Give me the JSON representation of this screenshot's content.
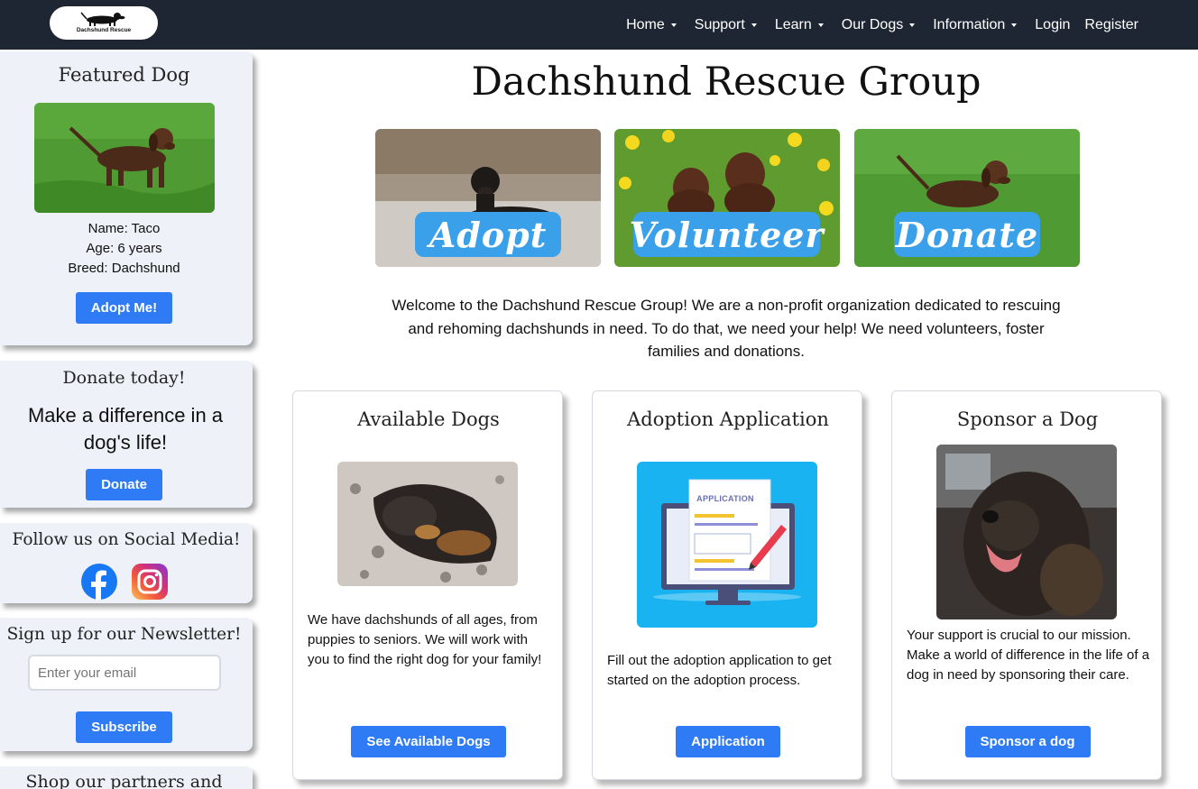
{
  "header": {
    "logo_text": "Dachshund Rescue",
    "nav": [
      {
        "label": "Home",
        "dropdown": true
      },
      {
        "label": "Support",
        "dropdown": true
      },
      {
        "label": "Learn",
        "dropdown": true
      },
      {
        "label": "Our Dogs",
        "dropdown": true
      },
      {
        "label": "Information",
        "dropdown": true
      },
      {
        "label": "Login",
        "dropdown": false
      },
      {
        "label": "Register",
        "dropdown": false
      }
    ]
  },
  "sidebar": {
    "featured": {
      "title": "Featured Dog",
      "name": "Name: Taco",
      "age": "Age: 6 years",
      "breed": "Breed: Dachshund",
      "button": "Adopt Me!"
    },
    "donate": {
      "title": "Donate today!",
      "text": "Make a difference in a dog's life!",
      "button": "Donate"
    },
    "social": {
      "title": "Follow us on Social Media!",
      "icons": [
        "facebook-icon",
        "instagram-icon"
      ]
    },
    "newsletter": {
      "title": "Sign up for our Newsletter!",
      "placeholder": "Enter your email",
      "button": "Subscribe"
    },
    "shop": {
      "title": "Shop our partners and"
    }
  },
  "main": {
    "title": "Dachshund Rescue Group",
    "heroes": [
      {
        "label": "Adopt"
      },
      {
        "label": "Volunteer"
      },
      {
        "label": "Donate"
      }
    ],
    "welcome": "Welcome to the Dachshund Rescue Group! We are a non-profit organization dedicated to rescuing and rehoming dachshunds in need. To do that, we need your help! We need volunteers, foster families and donations.",
    "cards": [
      {
        "title": "Available Dogs",
        "text": "We have dachshunds of all ages, from puppies to seniors. We will work with you to find the right dog for your family!",
        "button": "See Available Dogs"
      },
      {
        "title": "Adoption Application",
        "image_text": "APPLICATION",
        "text": "Fill out the adoption application to get started on the adoption process.",
        "button": "Application"
      },
      {
        "title": "Sponsor a Dog",
        "text": "Your support is crucial to our mission. Make a world of difference in the life of a dog in need by sponsoring their care.",
        "button": "Sponsor a dog"
      }
    ]
  },
  "colors": {
    "navbar": "#1f2633",
    "accent": "#2f7bf5",
    "sidebar_bg": "#eef1f7",
    "hero_label": "#3aa0ea"
  }
}
